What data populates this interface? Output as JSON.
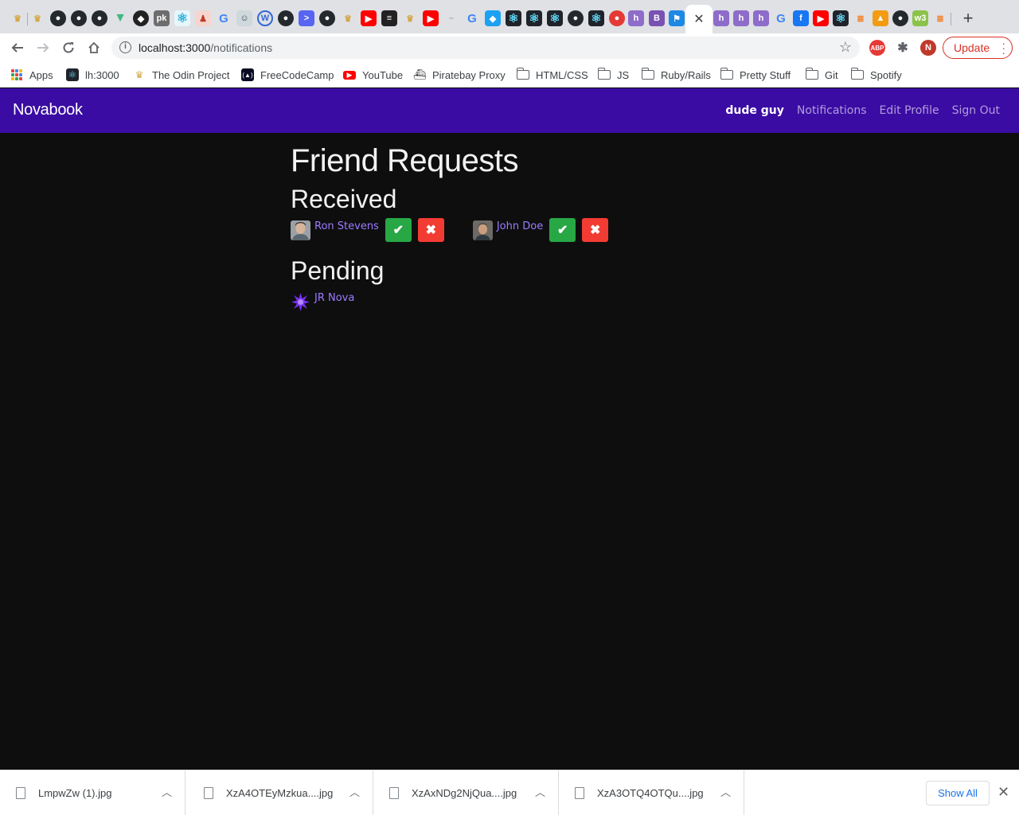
{
  "browser": {
    "url_host": "localhost:3000",
    "url_path": "/notifications",
    "update_label": "Update",
    "profile_initial": "N",
    "ext_abp_label": "ABP",
    "tab_close_glyph": "✕",
    "newtab_glyph": "+",
    "tab_letters": [
      "B"
    ],
    "bookmarks": [
      {
        "label": "Apps",
        "icon": "apps-grid-icon"
      },
      {
        "label": "lh:3000",
        "icon": "react-icon"
      },
      {
        "label": "The Odin Project",
        "icon": "odin-icon"
      },
      {
        "label": "FreeCodeCamp",
        "icon": "freecodecamp-icon"
      },
      {
        "label": "YouTube",
        "icon": "youtube-icon"
      },
      {
        "label": "Piratebay Proxy",
        "icon": "ship-icon"
      },
      {
        "label": "HTML/CSS",
        "icon": "folder-icon"
      },
      {
        "label": "JS",
        "icon": "folder-icon"
      },
      {
        "label": "Ruby/Rails",
        "icon": "folder-icon"
      },
      {
        "label": "Pretty Stuff",
        "icon": "folder-icon"
      },
      {
        "label": "Git",
        "icon": "folder-icon"
      },
      {
        "label": "Spotify",
        "icon": "folder-icon"
      }
    ]
  },
  "app": {
    "brand": "Novabook",
    "current_user": "dude guy",
    "nav": {
      "notifications": "Notifications",
      "edit_profile": "Edit Profile",
      "sign_out": "Sign Out"
    },
    "colors": {
      "navbar": "#3a0ca3",
      "link": "#9d7bff",
      "accept": "#28a745",
      "decline": "#f23c33"
    }
  },
  "page": {
    "title": "Friend Requests",
    "received_heading": "Received",
    "received": [
      {
        "name": "Ron Stevens",
        "avatar": "photo"
      },
      {
        "name": "John Doe",
        "avatar": "photo"
      }
    ],
    "pending_heading": "Pending",
    "pending": [
      {
        "name": "JR Nova",
        "avatar": "purple-star"
      }
    ],
    "accept_glyph": "✔",
    "decline_glyph": "✖"
  },
  "downloads": {
    "files": [
      "LmpwZw (1).jpg",
      "XzA4OTEyMzkua....jpg",
      "XzAxNDg2NjQua....jpg",
      "XzA3OTQ4OTQu....jpg"
    ],
    "show_all": "Show All"
  }
}
